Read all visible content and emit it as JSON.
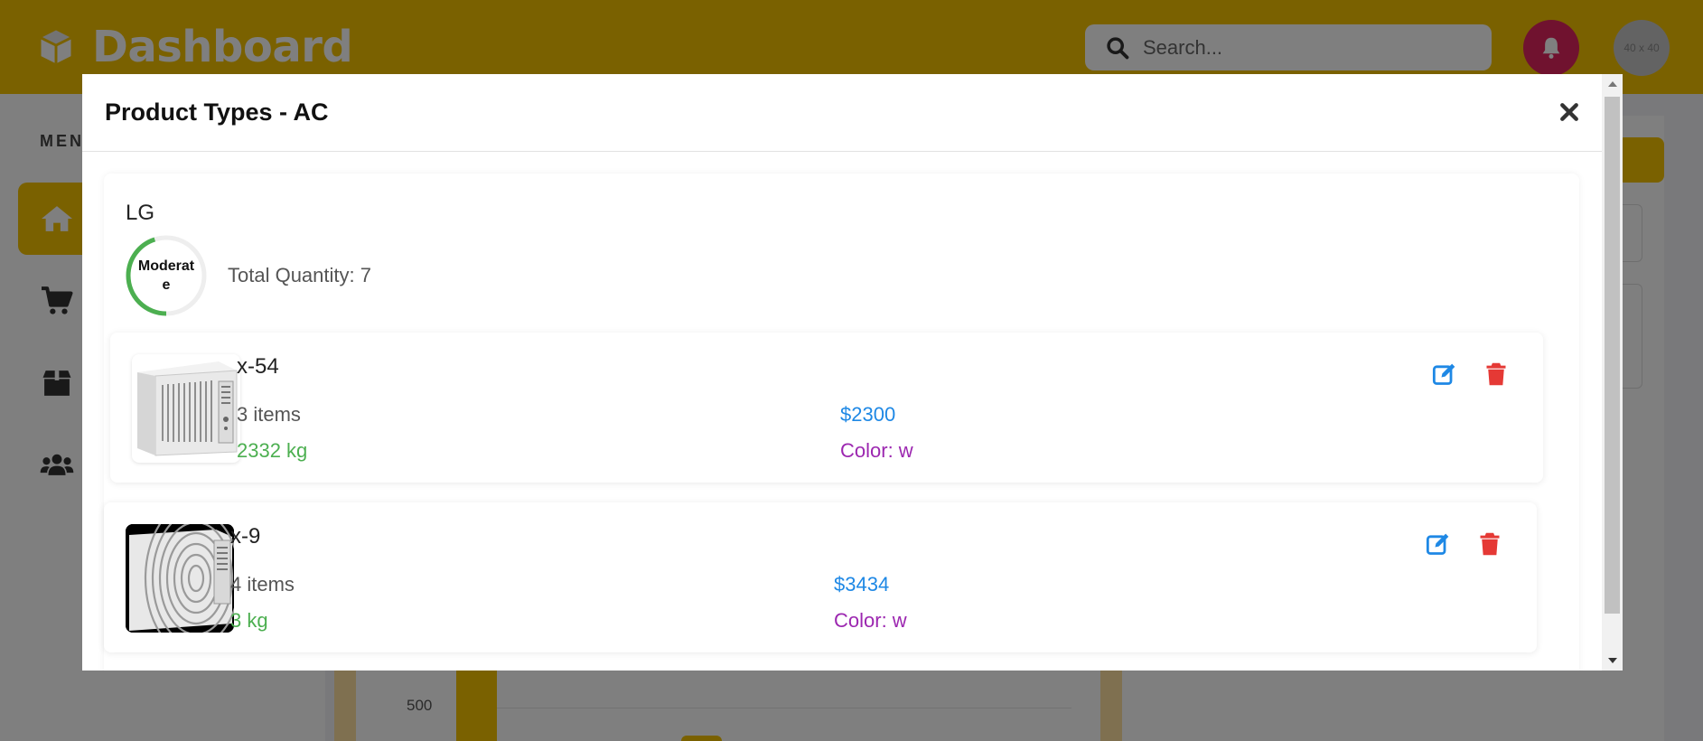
{
  "app": {
    "title": "Dashboard",
    "brand_color": "#f5c200"
  },
  "header": {
    "search_placeholder": "Search...",
    "avatar_text": "40 x 40"
  },
  "sidebar": {
    "menu_label": "MEN",
    "items": [
      {
        "icon": "home-icon",
        "active": true
      },
      {
        "icon": "cart-icon",
        "active": false
      },
      {
        "icon": "box-icon",
        "active": false
      },
      {
        "icon": "users-icon",
        "active": false
      }
    ]
  },
  "background_chart": {
    "tick_label": "500"
  },
  "modal": {
    "title": "Product Types - AC",
    "brand": {
      "name": "LG",
      "stock_status": "Moderate",
      "stock_fill": 0.45,
      "total_quantity": "Total Quantity: 7"
    },
    "products": [
      {
        "name": "x-54",
        "items": "3 items",
        "weight": "2332 kg",
        "price": "$2300",
        "color": "Color: w"
      },
      {
        "name": "x-9",
        "items": "4 items",
        "weight": "3 kg",
        "price": "$3434",
        "color": "Color: w"
      }
    ]
  },
  "colors": {
    "price": "#1e88e5",
    "weight": "#4caf50",
    "color_text": "#9c27b0",
    "delete": "#e53935",
    "edit": "#1e88e5",
    "notification": "#e0245e"
  }
}
